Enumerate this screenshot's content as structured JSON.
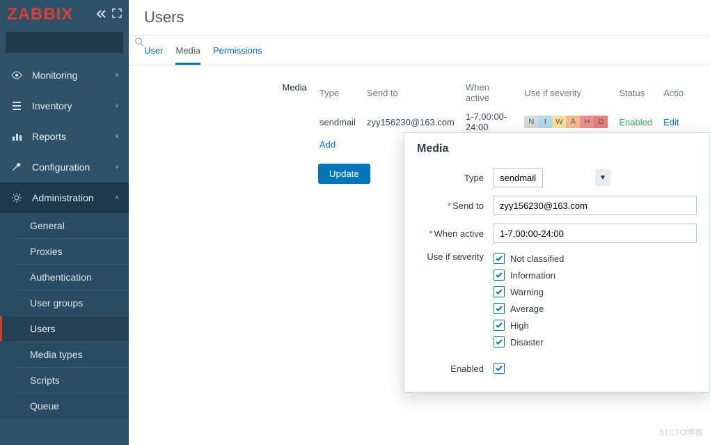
{
  "app": {
    "logo": "ZABBIX"
  },
  "sidebar": {
    "search_placeholder": "",
    "items": [
      {
        "icon": "eye",
        "label": "Monitoring",
        "expanded": false
      },
      {
        "icon": "list",
        "label": "Inventory",
        "expanded": false
      },
      {
        "icon": "bar",
        "label": "Reports",
        "expanded": false
      },
      {
        "icon": "wrench",
        "label": "Configuration",
        "expanded": false
      },
      {
        "icon": "gear",
        "label": "Administration",
        "expanded": true,
        "active": true,
        "children": [
          {
            "label": "General"
          },
          {
            "label": "Proxies"
          },
          {
            "label": "Authentication"
          },
          {
            "label": "User groups"
          },
          {
            "label": "Users",
            "selected": true
          },
          {
            "label": "Media types"
          },
          {
            "label": "Scripts"
          },
          {
            "label": "Queue"
          }
        ]
      }
    ]
  },
  "page": {
    "title": "Users"
  },
  "tabs": [
    {
      "label": "User"
    },
    {
      "label": "Media",
      "active": true
    },
    {
      "label": "Permissions"
    }
  ],
  "media_section": {
    "label": "Media",
    "columns": {
      "type": "Type",
      "send_to": "Send to",
      "when_active": "When active",
      "severity": "Use if severity",
      "status": "Status",
      "action": "Actio"
    },
    "rows": [
      {
        "type": "sendmail",
        "send_to": "zyy156230@163.com",
        "when_active": "1-7,00:00-24:00",
        "severity": [
          "N",
          "I",
          "W",
          "A",
          "H",
          "D"
        ],
        "status": "Enabled",
        "action": "Edit"
      }
    ],
    "add_label": "Add",
    "update_label": "Update"
  },
  "overlay": {
    "title": "Media",
    "type_label": "Type",
    "type_value": "sendmail",
    "send_to_label": "Send to",
    "send_to_value": "zyy156230@163.com",
    "when_active_label": "When active",
    "when_active_value": "1-7,00:00-24:00",
    "severity_label": "Use if severity",
    "severities": [
      {
        "label": "Not classified",
        "checked": true
      },
      {
        "label": "Information",
        "checked": true
      },
      {
        "label": "Warning",
        "checked": true
      },
      {
        "label": "Average",
        "checked": true
      },
      {
        "label": "High",
        "checked": true
      },
      {
        "label": "Disaster",
        "checked": true
      }
    ],
    "enabled_label": "Enabled",
    "enabled_checked": true
  },
  "watermark": "51CTO博客"
}
